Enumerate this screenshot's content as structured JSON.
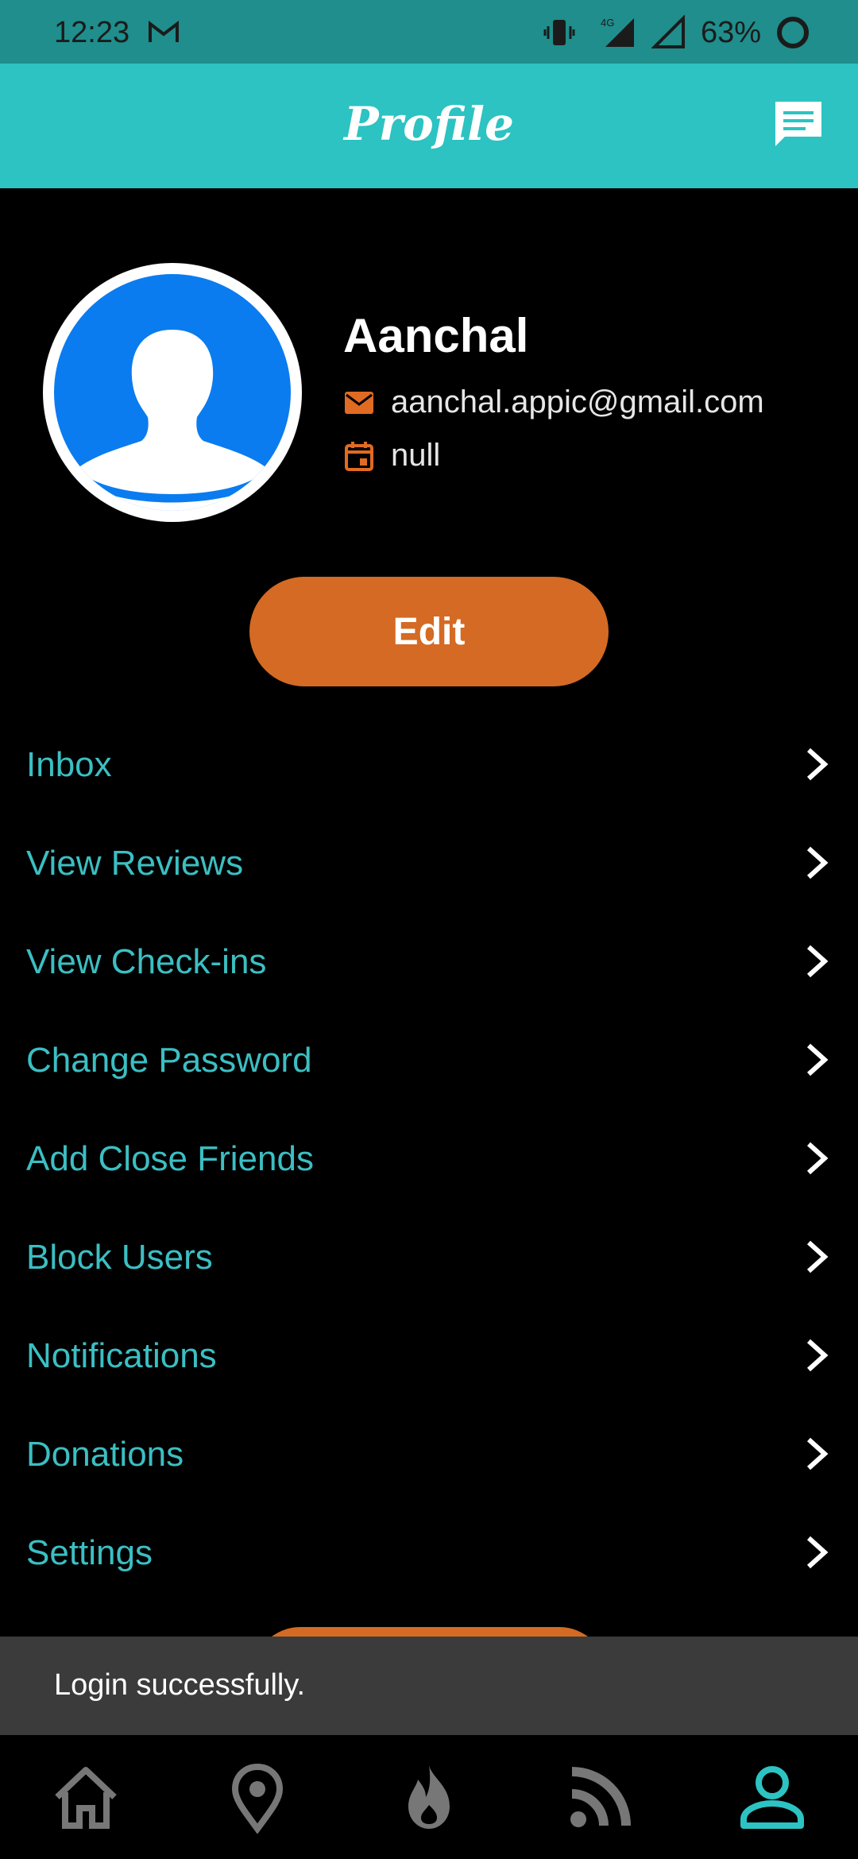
{
  "status_bar": {
    "time": "12:23",
    "network": "4G",
    "battery": "63%"
  },
  "app_bar": {
    "title": "Profile"
  },
  "profile": {
    "name": "Aanchal",
    "email": "aanchal.appic@gmail.com",
    "date": "null",
    "edit_label": "Edit"
  },
  "menu": [
    {
      "label": "Inbox"
    },
    {
      "label": "View Reviews"
    },
    {
      "label": "View Check-ins"
    },
    {
      "label": "Change Password"
    },
    {
      "label": "Add Close Friends"
    },
    {
      "label": "Block Users"
    },
    {
      "label": "Notifications"
    },
    {
      "label": "Donations"
    },
    {
      "label": "Settings"
    }
  ],
  "toast": {
    "message": "Login successfully."
  },
  "bottom_nav": [
    {
      "icon": "home-icon",
      "active": false
    },
    {
      "icon": "location-pin-icon",
      "active": false
    },
    {
      "icon": "flame-icon",
      "active": false
    },
    {
      "icon": "rss-feed-icon",
      "active": false
    },
    {
      "icon": "person-icon",
      "active": true
    }
  ],
  "colors": {
    "accent": "#2cc3c2",
    "menu_text": "#3bbfc3",
    "button": "#d46a24",
    "avatar_bg": "#0a7cf0"
  }
}
